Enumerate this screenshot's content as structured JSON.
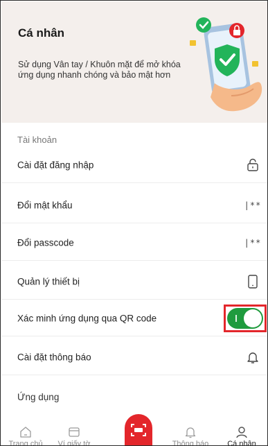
{
  "header": {
    "title": "Cá nhân",
    "description": "Sử dụng Vân tay / Khuôn mặt để mở khóa ứng dụng nhanh chóng và bảo mật hơn"
  },
  "sections": {
    "account_label": "Tài khoản",
    "app_label": "Ứng dụng"
  },
  "rows": [
    {
      "label": "Cài đặt đăng nhập",
      "icon": "lock-icon"
    },
    {
      "label": "Đổi mật khẩu",
      "icon": "password-icon",
      "icon_text": "|**"
    },
    {
      "label": "Đổi passcode",
      "icon": "passcode-icon",
      "icon_text": "|**"
    },
    {
      "label": "Quản lý thiết bị",
      "icon": "phone-icon"
    },
    {
      "label": "Xác minh ứng dụng qua QR code",
      "icon": "toggle",
      "toggle_on": true
    },
    {
      "label": "Cài đặt thông báo",
      "icon": "bell-icon"
    }
  ],
  "bottom_nav": {
    "items": [
      {
        "label": "Trang chủ",
        "icon": "home-icon",
        "active": false
      },
      {
        "label": "Ví giấy tờ",
        "icon": "wallet-icon",
        "active": false
      },
      {
        "label": "",
        "icon": "scan-icon",
        "active": false
      },
      {
        "label": "Thông báo",
        "icon": "bell-icon",
        "active": false
      },
      {
        "label": "Cá nhân",
        "icon": "person-icon",
        "active": true
      }
    ]
  },
  "colors": {
    "accent": "#e3262b",
    "toggle_on": "#1f9b3e",
    "header_bg": "#f4efec"
  }
}
